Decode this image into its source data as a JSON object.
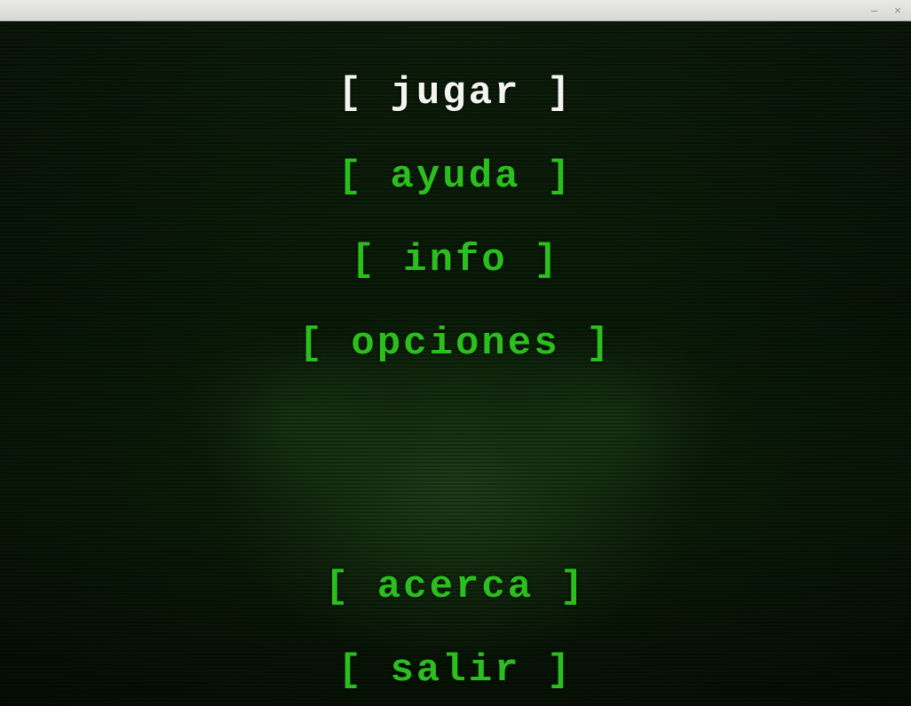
{
  "menu": {
    "items": [
      {
        "label": "[ jugar ]",
        "selected": true
      },
      {
        "label": "[ ayuda ]",
        "selected": false
      },
      {
        "label": "[ info ]",
        "selected": false
      },
      {
        "label": "[ opciones ]",
        "selected": false
      },
      {
        "label": "[ acerca ]",
        "selected": false
      },
      {
        "label": "[ salir ]",
        "selected": false
      }
    ]
  },
  "colors": {
    "selected": "#f4f4f0",
    "normal": "#2bbf1e",
    "background": "#0a1808"
  }
}
